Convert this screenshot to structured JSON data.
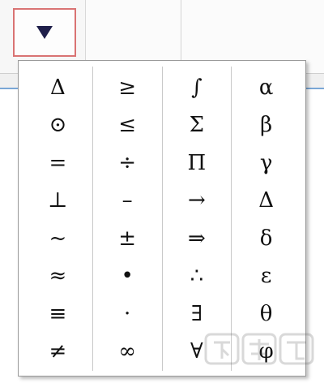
{
  "dropdown": {
    "icon": "triangle-down-icon",
    "color": "#1f1f4a",
    "border_color": "#d97373"
  },
  "symbols": {
    "columns": [
      [
        "Δ",
        "⊙",
        "=",
        "⊥",
        "~",
        "≈",
        "≡",
        "≠"
      ],
      [
        "≥",
        "≤",
        "÷",
        "–",
        "±",
        "•",
        "·",
        "∞"
      ],
      [
        "∫",
        "Σ",
        "Π",
        "→",
        "⇒",
        "∴",
        "∃",
        "∀"
      ],
      [
        "α",
        "β",
        "γ",
        "Δ",
        "δ",
        "ε",
        "θ",
        "φ"
      ]
    ]
  },
  "watermark": {
    "text": "下载吧",
    "url": "www.xiazaiba.com"
  }
}
